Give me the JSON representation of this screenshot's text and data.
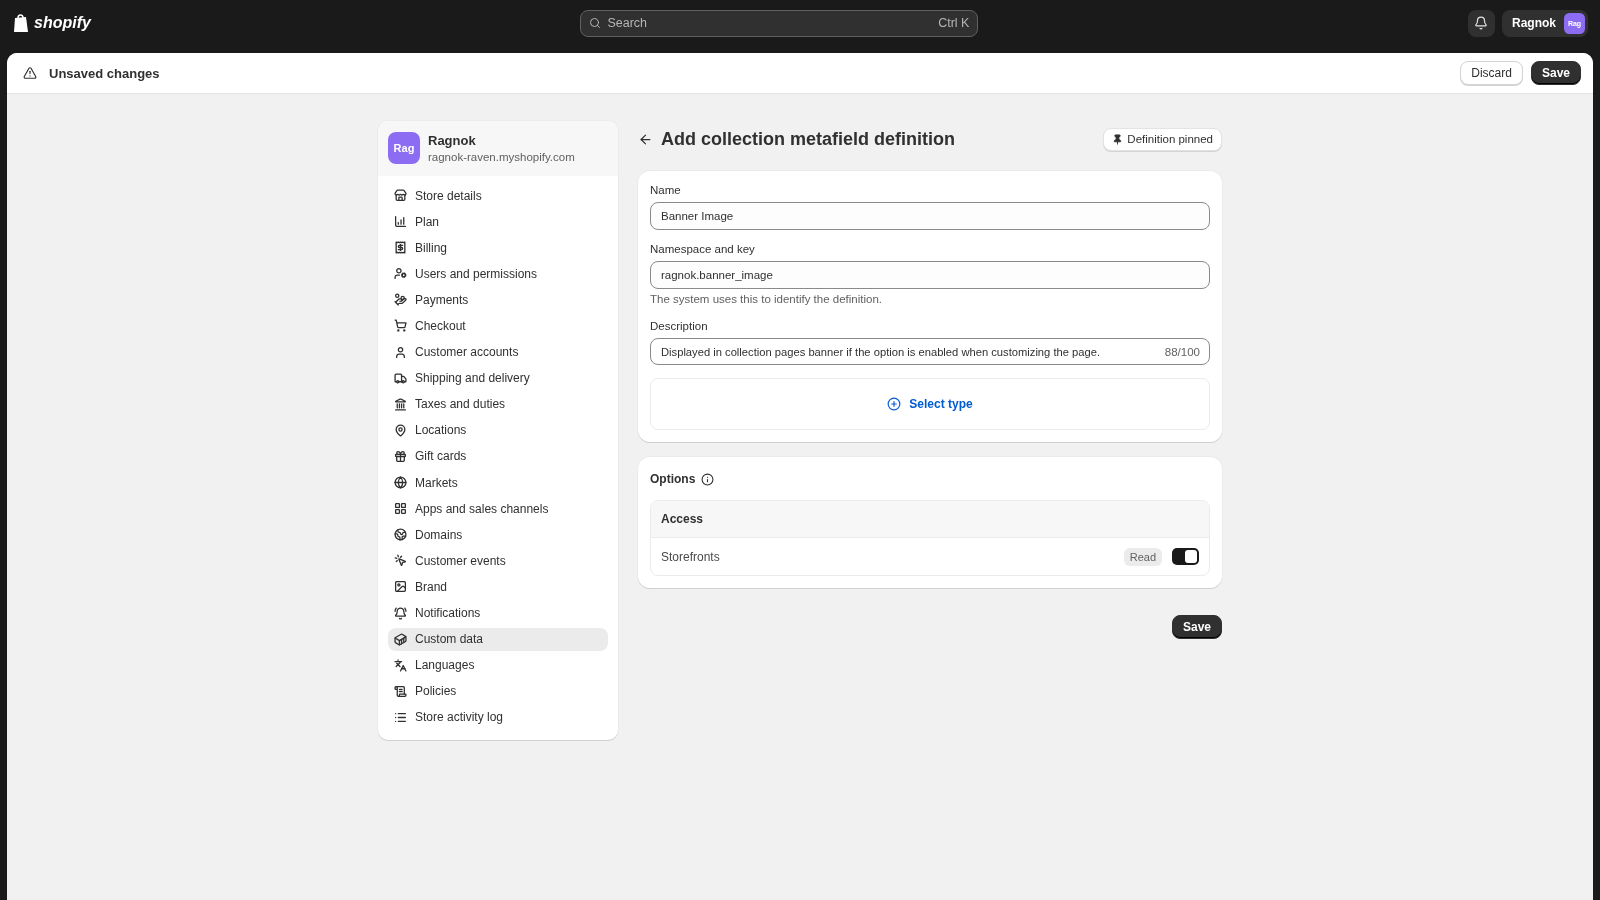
{
  "top_bar": {
    "logo": "shopify",
    "search": {
      "placeholder": "Search",
      "shortcut": "Ctrl K"
    },
    "account": {
      "name": "Ragnok",
      "avatar": "Rag"
    }
  },
  "save_bar": {
    "title": "Unsaved changes",
    "buttons": [
      "Discard",
      "Save"
    ]
  },
  "store": {
    "avatar": "Rag",
    "name": "Ragnok",
    "domain": "ragnok-raven.myshopify.com"
  },
  "sidebar": {
    "items": [
      {
        "label": "Store details",
        "selected": false
      },
      {
        "label": "Plan",
        "selected": false
      },
      {
        "label": "Billing",
        "selected": false
      },
      {
        "label": "Users and permissions",
        "selected": false
      },
      {
        "label": "Payments",
        "selected": false
      },
      {
        "label": "Checkout",
        "selected": false
      },
      {
        "label": "Customer accounts",
        "selected": false
      },
      {
        "label": "Shipping and delivery",
        "selected": false
      },
      {
        "label": "Taxes and duties",
        "selected": false
      },
      {
        "label": "Locations",
        "selected": false
      },
      {
        "label": "Gift cards",
        "selected": false
      },
      {
        "label": "Markets",
        "selected": false
      },
      {
        "label": "Apps and sales channels",
        "selected": false
      },
      {
        "label": "Domains",
        "selected": false
      },
      {
        "label": "Customer events",
        "selected": false
      },
      {
        "label": "Brand",
        "selected": false
      },
      {
        "label": "Notifications",
        "selected": false
      },
      {
        "label": "Custom data",
        "selected": true
      },
      {
        "label": "Languages",
        "selected": false
      },
      {
        "label": "Policies",
        "selected": false
      },
      {
        "label": "Store activity log",
        "selected": false
      }
    ]
  },
  "page": {
    "title": "Add collection metafield definition",
    "pin_button": "Definition pinned"
  },
  "form": {
    "name": {
      "label": "Name",
      "value": "Banner Image"
    },
    "namespace": {
      "label": "Namespace and key",
      "value": "ragnok.banner_image",
      "help": "The system uses this to identify the definition."
    },
    "description": {
      "label": "Description",
      "value": "Displayed in collection pages banner if the option is enabled when customizing the page.",
      "count": "88/100"
    },
    "select_type": "Select type"
  },
  "options": {
    "title": "Options",
    "table_header": "Access",
    "rows": [
      {
        "label": "Storefronts",
        "badge": "Read",
        "on": true
      }
    ]
  },
  "footer": {
    "save": "Save"
  }
}
